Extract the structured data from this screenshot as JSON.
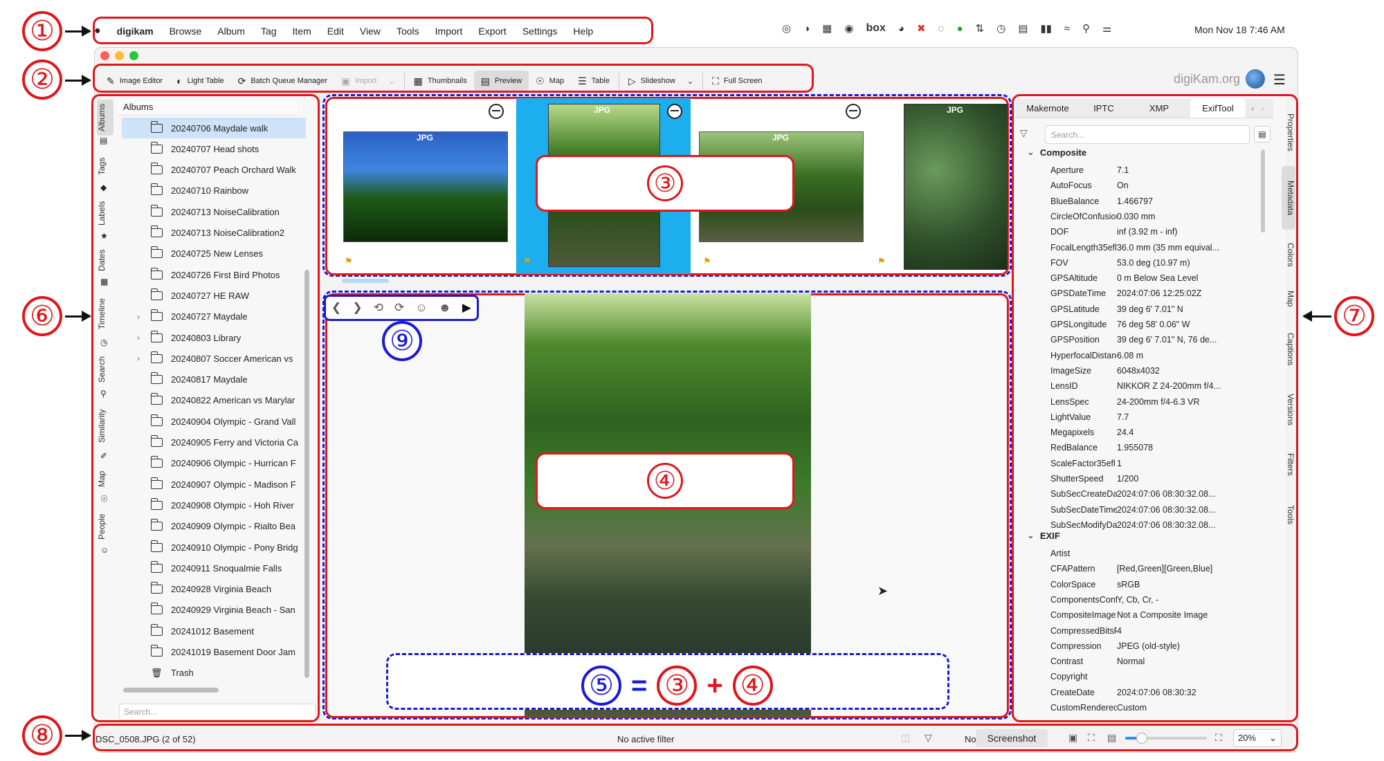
{
  "menubar": {
    "app_name": "digikam",
    "items": [
      "Browse",
      "Album",
      "Tag",
      "Item",
      "Edit",
      "View",
      "Tools",
      "Import",
      "Export",
      "Settings",
      "Help"
    ],
    "tray_text": "box",
    "clock": "Mon Nov 18  7:46 AM"
  },
  "toolbar": {
    "image_editor": "Image Editor",
    "light_table": "Light Table",
    "batch_queue": "Batch Queue Manager",
    "import": "Import",
    "thumbnails": "Thumbnails",
    "preview": "Preview",
    "map": "Map",
    "table": "Table",
    "slideshow": "Slideshow",
    "full_screen": "Full Screen",
    "brand": "digiKam.org"
  },
  "left_tabs": [
    "Albums",
    "Tags",
    "Labels",
    "Dates",
    "Timeline",
    "Search",
    "Similarity",
    "Map",
    "People"
  ],
  "albums": {
    "header": "Albums",
    "items": [
      "20240706 Maydale walk",
      "20240707 Head shots",
      "20240707 Peach Orchard Walk",
      "20240710 Rainbow",
      "20240713 NoiseCalibration",
      "20240713 NoiseCalibration2",
      "20240725 New Lenses",
      "20240726 First Bird Photos",
      "20240727 HE RAW",
      "20240727 Maydale",
      "20240803 Library",
      "20240807 Soccer American vs",
      "20240817 Maydale",
      "20240822 American vs Marylar",
      "20240904 Olympic - Grand Vall",
      "20240905 Ferry and Victoria Ca",
      "20240906 Olympic - Hurrican F",
      "20240907 Olympic - Madison F",
      "20240908 Olympic - Hoh River",
      "20240909 Olympic - Rialto Bea",
      "20240910 Olympic - Pony Bridg",
      "20240911 Snoqualmie Falls",
      "20240928 Virginia Beach",
      "20240929 Virginia Beach - San",
      "20241012 Basement",
      "20241019 Basement Door Jam",
      "Trash"
    ],
    "search_placeholder": "Search..."
  },
  "filmstrip": {
    "badge": "JPG"
  },
  "right_panel": {
    "tabs": [
      "Makernote",
      "IPTC",
      "XMP",
      "ExifTool"
    ],
    "search_placeholder": "Search...",
    "vertical_tabs": [
      "Properties",
      "Metadata",
      "Colors",
      "Map",
      "Captions",
      "Versions",
      "Filters",
      "Tools"
    ],
    "composite_title": "Composite",
    "composite": [
      {
        "k": "Aperture",
        "v": "7.1"
      },
      {
        "k": "AutoFocus",
        "v": "On"
      },
      {
        "k": "BlueBalance",
        "v": "1.466797"
      },
      {
        "k": "CircleOfConfusion",
        "v": "0.030 mm"
      },
      {
        "k": "DOF",
        "v": "inf (3.92 m - inf)"
      },
      {
        "k": "FocalLength35efl",
        "v": "36.0 mm (35 mm equival..."
      },
      {
        "k": "FOV",
        "v": "53.0 deg (10.97 m)"
      },
      {
        "k": "GPSAltitude",
        "v": "0 m Below Sea Level"
      },
      {
        "k": "GPSDateTime",
        "v": "2024:07:06 12:25:02Z"
      },
      {
        "k": "GPSLatitude",
        "v": "39 deg 6' 7.01\" N"
      },
      {
        "k": "GPSLongitude",
        "v": "76 deg 58' 0.06\" W"
      },
      {
        "k": "GPSPosition",
        "v": "39 deg 6' 7.01\" N, 76 de..."
      },
      {
        "k": "HyperfocalDistance",
        "v": "6.08 m"
      },
      {
        "k": "ImageSize",
        "v": "6048x4032"
      },
      {
        "k": "LensID",
        "v": "NIKKOR Z 24-200mm f/4..."
      },
      {
        "k": "LensSpec",
        "v": "24-200mm f/4-6.3 VR"
      },
      {
        "k": "LightValue",
        "v": "7.7"
      },
      {
        "k": "Megapixels",
        "v": "24.4"
      },
      {
        "k": "RedBalance",
        "v": "1.955078"
      },
      {
        "k": "ScaleFactor35efl",
        "v": "1"
      },
      {
        "k": "ShutterSpeed",
        "v": "1/200"
      },
      {
        "k": "SubSecCreateDate",
        "v": "2024:07:06 08:30:32.08..."
      },
      {
        "k": "SubSecDateTimeO...",
        "v": "2024:07:06 08:30:32.08..."
      },
      {
        "k": "SubSecModifyDate",
        "v": "2024:07:06 08:30:32.08..."
      }
    ],
    "exif_title": "EXIF",
    "exif": [
      {
        "k": "Artist",
        "v": ""
      },
      {
        "k": "CFAPattern",
        "v": "[Red,Green][Green,Blue]"
      },
      {
        "k": "ColorSpace",
        "v": "sRGB"
      },
      {
        "k": "ComponentsConfi...",
        "v": "Y, Cb, Cr, -"
      },
      {
        "k": "CompositeImage",
        "v": "Not a Composite Image"
      },
      {
        "k": "CompressedBitsP...",
        "v": "4"
      },
      {
        "k": "Compression",
        "v": "JPEG (old-style)"
      },
      {
        "k": "Contrast",
        "v": "Normal"
      },
      {
        "k": "Copyright",
        "v": ""
      },
      {
        "k": "CreateDate",
        "v": "2024:07:06 08:30:32"
      },
      {
        "k": "CustomRendered",
        "v": "Custom"
      }
    ]
  },
  "statusbar": {
    "file": "DSC_0508.JPG (2 of 52)",
    "filter": "No active filter",
    "no": "No",
    "screenshot": "Screenshot",
    "zoom": "20%",
    "zoom_level": 0.2
  },
  "callouts": {
    "n1": "①",
    "n2": "②",
    "n3": "③",
    "n4": "④",
    "n6": "⑥",
    "n7": "⑦",
    "n8": "⑧",
    "n9": "⑨",
    "n5": "⑤",
    "eq": "=",
    "plus": "+",
    "eq_a": "③",
    "eq_b": "④"
  },
  "colors": {
    "callout_red": "#e0161b",
    "callout_blue": "#1a1ad6",
    "selection_blue": "#1daeef"
  }
}
